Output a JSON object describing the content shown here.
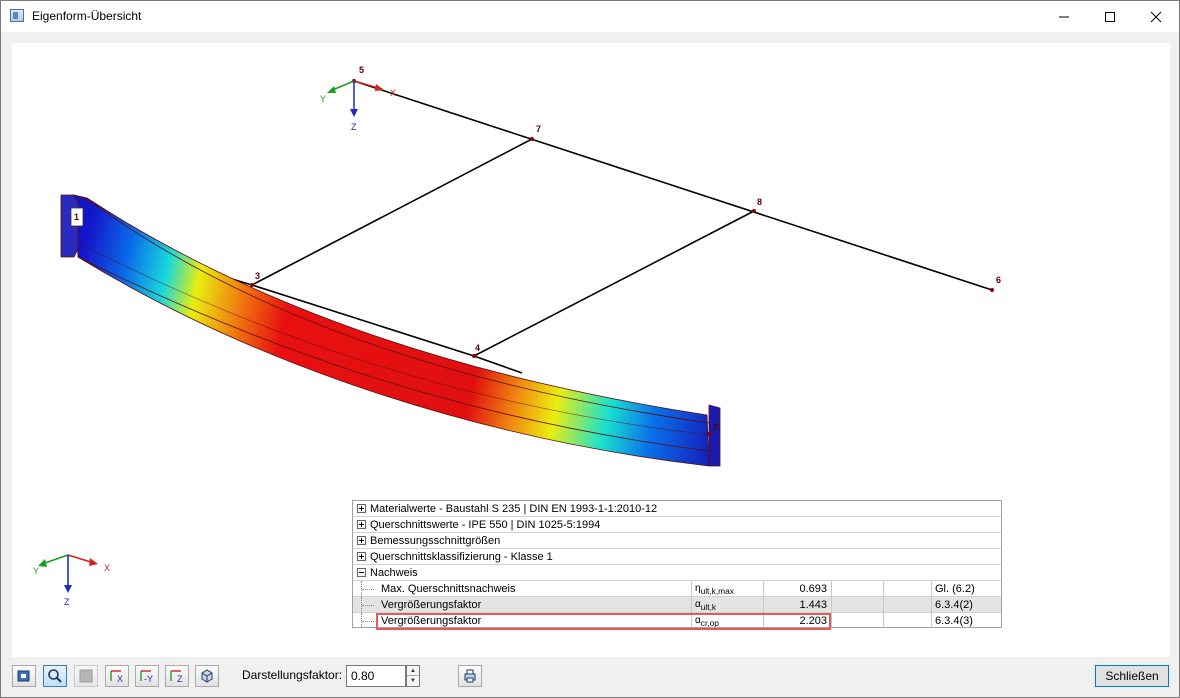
{
  "window": {
    "title": "Eigenform-Übersicht"
  },
  "model": {
    "nodes": [
      "1",
      "2",
      "3",
      "4",
      "5",
      "6",
      "7",
      "8"
    ],
    "axes": {
      "x": "X",
      "y": "Y",
      "z": "Z"
    },
    "colors": {
      "member_line": "#000000",
      "node": "#8b0000",
      "x_axis": "#d42020",
      "y_axis": "#1e9e1e",
      "z_axis": "#1a2bbd"
    }
  },
  "results": {
    "groups": [
      {
        "label": "Materialwerte - Baustahl S 235 | DIN EN 1993-1-1:2010-12",
        "expanded": false
      },
      {
        "label": "Querschnittswerte  -  IPE 550 | DIN 1025-5:1994",
        "expanded": false
      },
      {
        "label": "Bemessungsschnittgrößen",
        "expanded": false
      },
      {
        "label": "Querschnittsklassifizierung - Klasse 1",
        "expanded": false
      },
      {
        "label": "Nachweis",
        "expanded": true
      }
    ],
    "rows": [
      {
        "desc": "Max. Querschnittsnachweis",
        "sym_main": "η",
        "sym_sub": "ult,k,max",
        "value": "0.693",
        "ref": "Gl. (6.2)"
      },
      {
        "desc": "Vergrößerungsfaktor",
        "sym_main": "α",
        "sym_sub": "ult,k",
        "value": "1.443",
        "ref": "6.3.4(2)"
      },
      {
        "desc": "Vergrößerungsfaktor",
        "sym_main": "α",
        "sym_sub": "cr,op",
        "value": "2.203",
        "ref": "6.3.4(3)"
      }
    ],
    "highlight_color": "#e35a5a"
  },
  "toolbar": {
    "factor_label": "Darstellungsfaktor:",
    "factor_value": "0.80",
    "close_label": "Schließen",
    "view_x": "X",
    "view_y": "-Y",
    "view_z": "Z"
  }
}
